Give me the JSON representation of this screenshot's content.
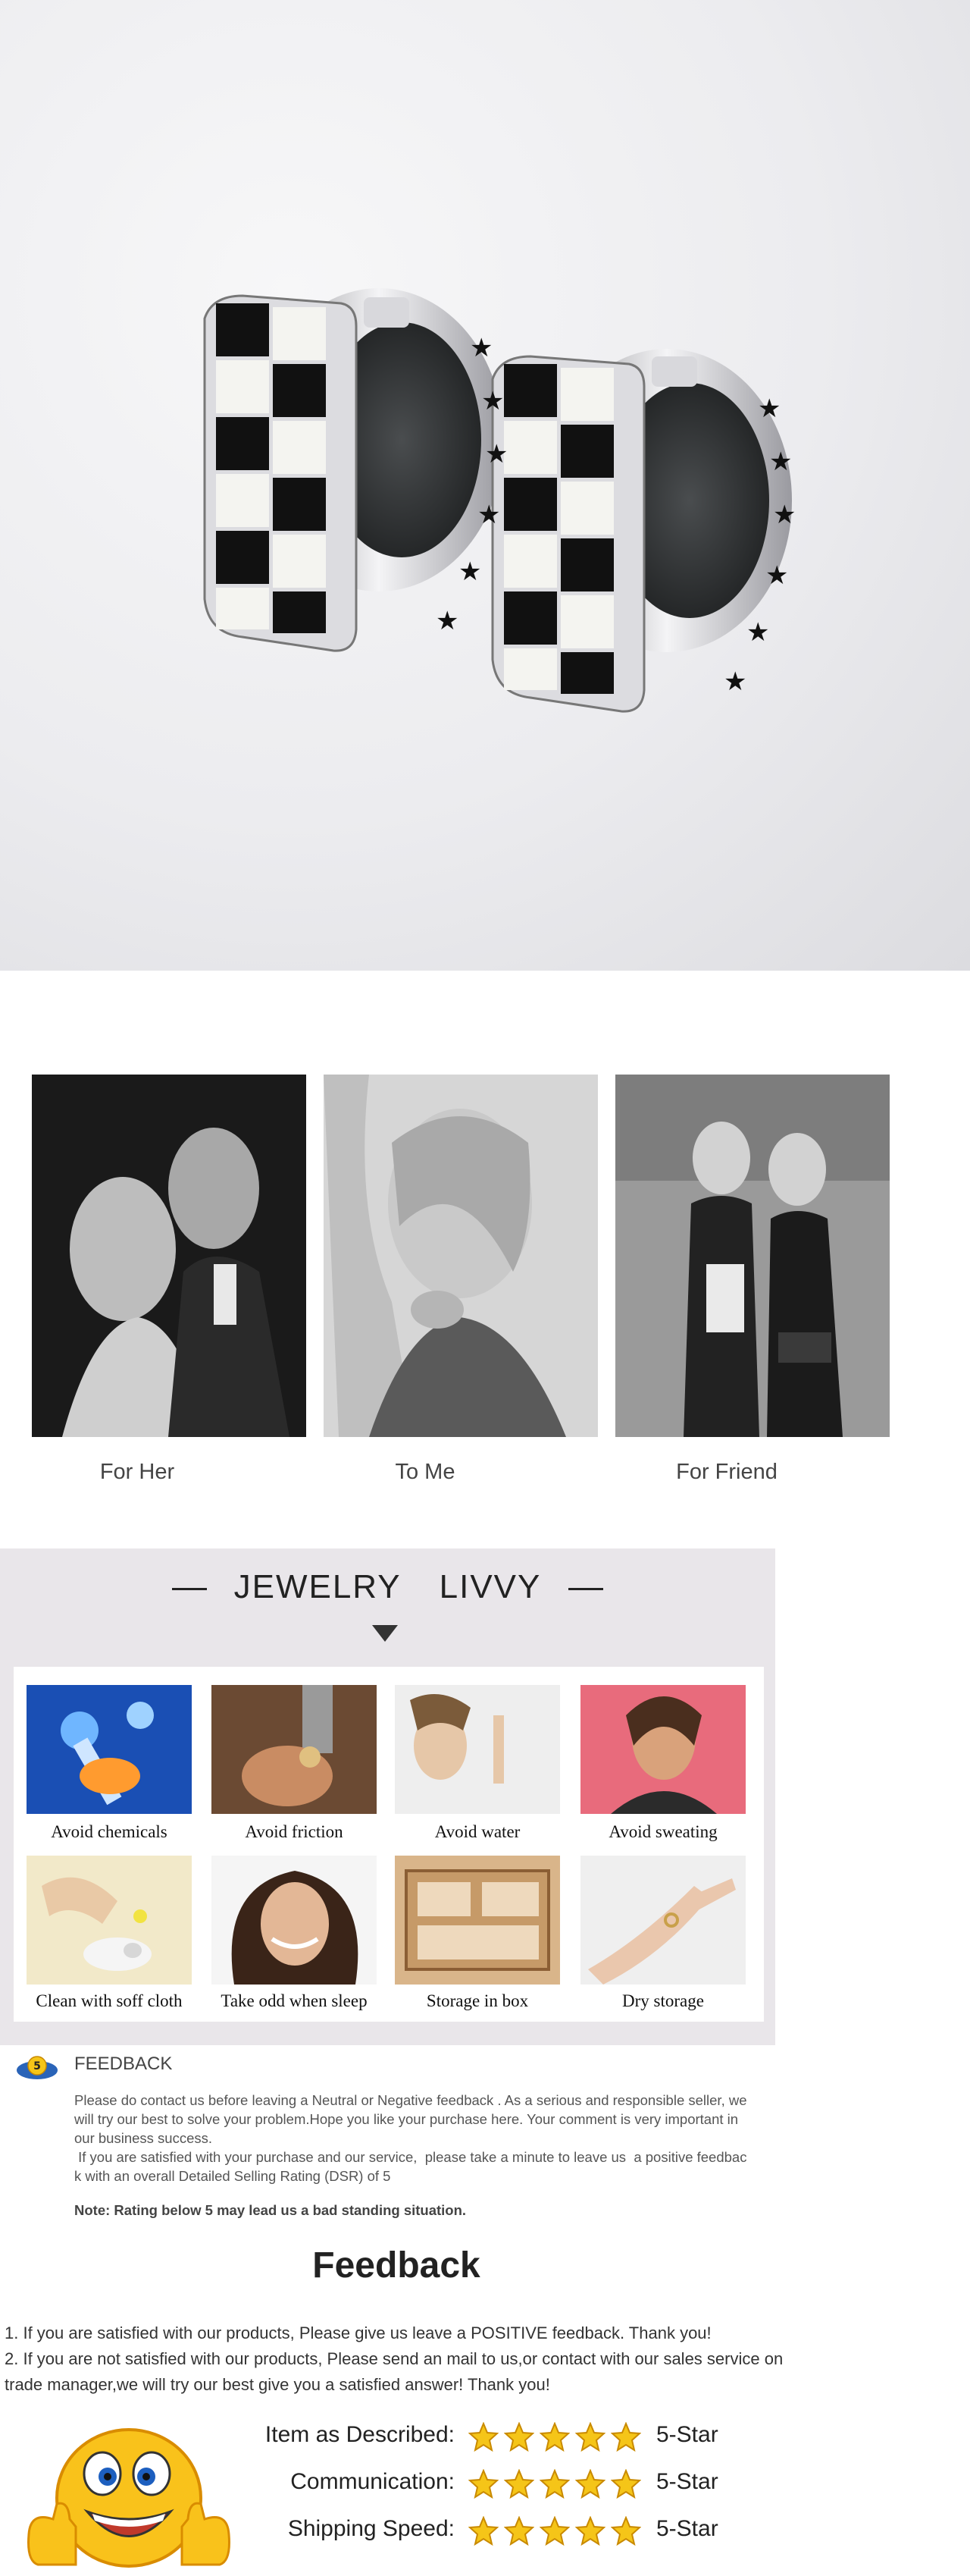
{
  "hero": {
    "product": "black and white enamel checkered hoop earrings with star cutouts"
  },
  "gift": {
    "items": [
      {
        "caption": "For Her"
      },
      {
        "caption": "To Me"
      },
      {
        "caption": "For Friend"
      }
    ]
  },
  "care": {
    "title_left": "JEWELRY",
    "title_right": "LIVVY",
    "items": [
      {
        "caption": "Avoid chemicals"
      },
      {
        "caption": "Avoid friction"
      },
      {
        "caption": "Avoid water"
      },
      {
        "caption": "Avoid sweating"
      },
      {
        "caption": "Clean with soff cloth"
      },
      {
        "caption": "Take odd when sleep"
      },
      {
        "caption": "Storage in box"
      },
      {
        "caption": "Dry storage"
      }
    ]
  },
  "feedback_notice": {
    "badge": "5",
    "heading": "FEEDBACK",
    "para1_l1": "Please do contact us before leaving a Neutral or Negative  feedback . As a serious and responsible seller, we",
    "para1_l2": "will try our best to solve your problem.Hope you like your purchase here. Your comment is very important in",
    "para1_l3": "our business success.",
    "para2_l1": " If you are satisfied with your purchase and our service,  please take a minute to leave us  a positive feedbac",
    "para2_l2": "k with an overall  Detailed Selling Rating (DSR) of 5",
    "note": "Note: Rating below 5 may lead us a bad standing situation."
  },
  "feedback": {
    "title": "Feedback",
    "line1": "1. If you are satisfied with our products, Please give us leave a POSITIVE feedback. Thank you!",
    "line2a": "2. If you are not satisfied with our products, Please send an mail to us,or contact with our sales service on",
    "line2b": "trade manager,we will try our best give you a satisfied answer! Thank you!",
    "ratings": [
      {
        "label": "Item as Described:",
        "stars": 5,
        "value": "5-Star"
      },
      {
        "label": "Communication:",
        "stars": 5,
        "value": "5-Star"
      },
      {
        "label": "Shipping Speed:",
        "stars": 5,
        "value": "5-Star"
      }
    ],
    "colors": {
      "star": "#f5c518",
      "star_outline": "#c98a00"
    }
  }
}
